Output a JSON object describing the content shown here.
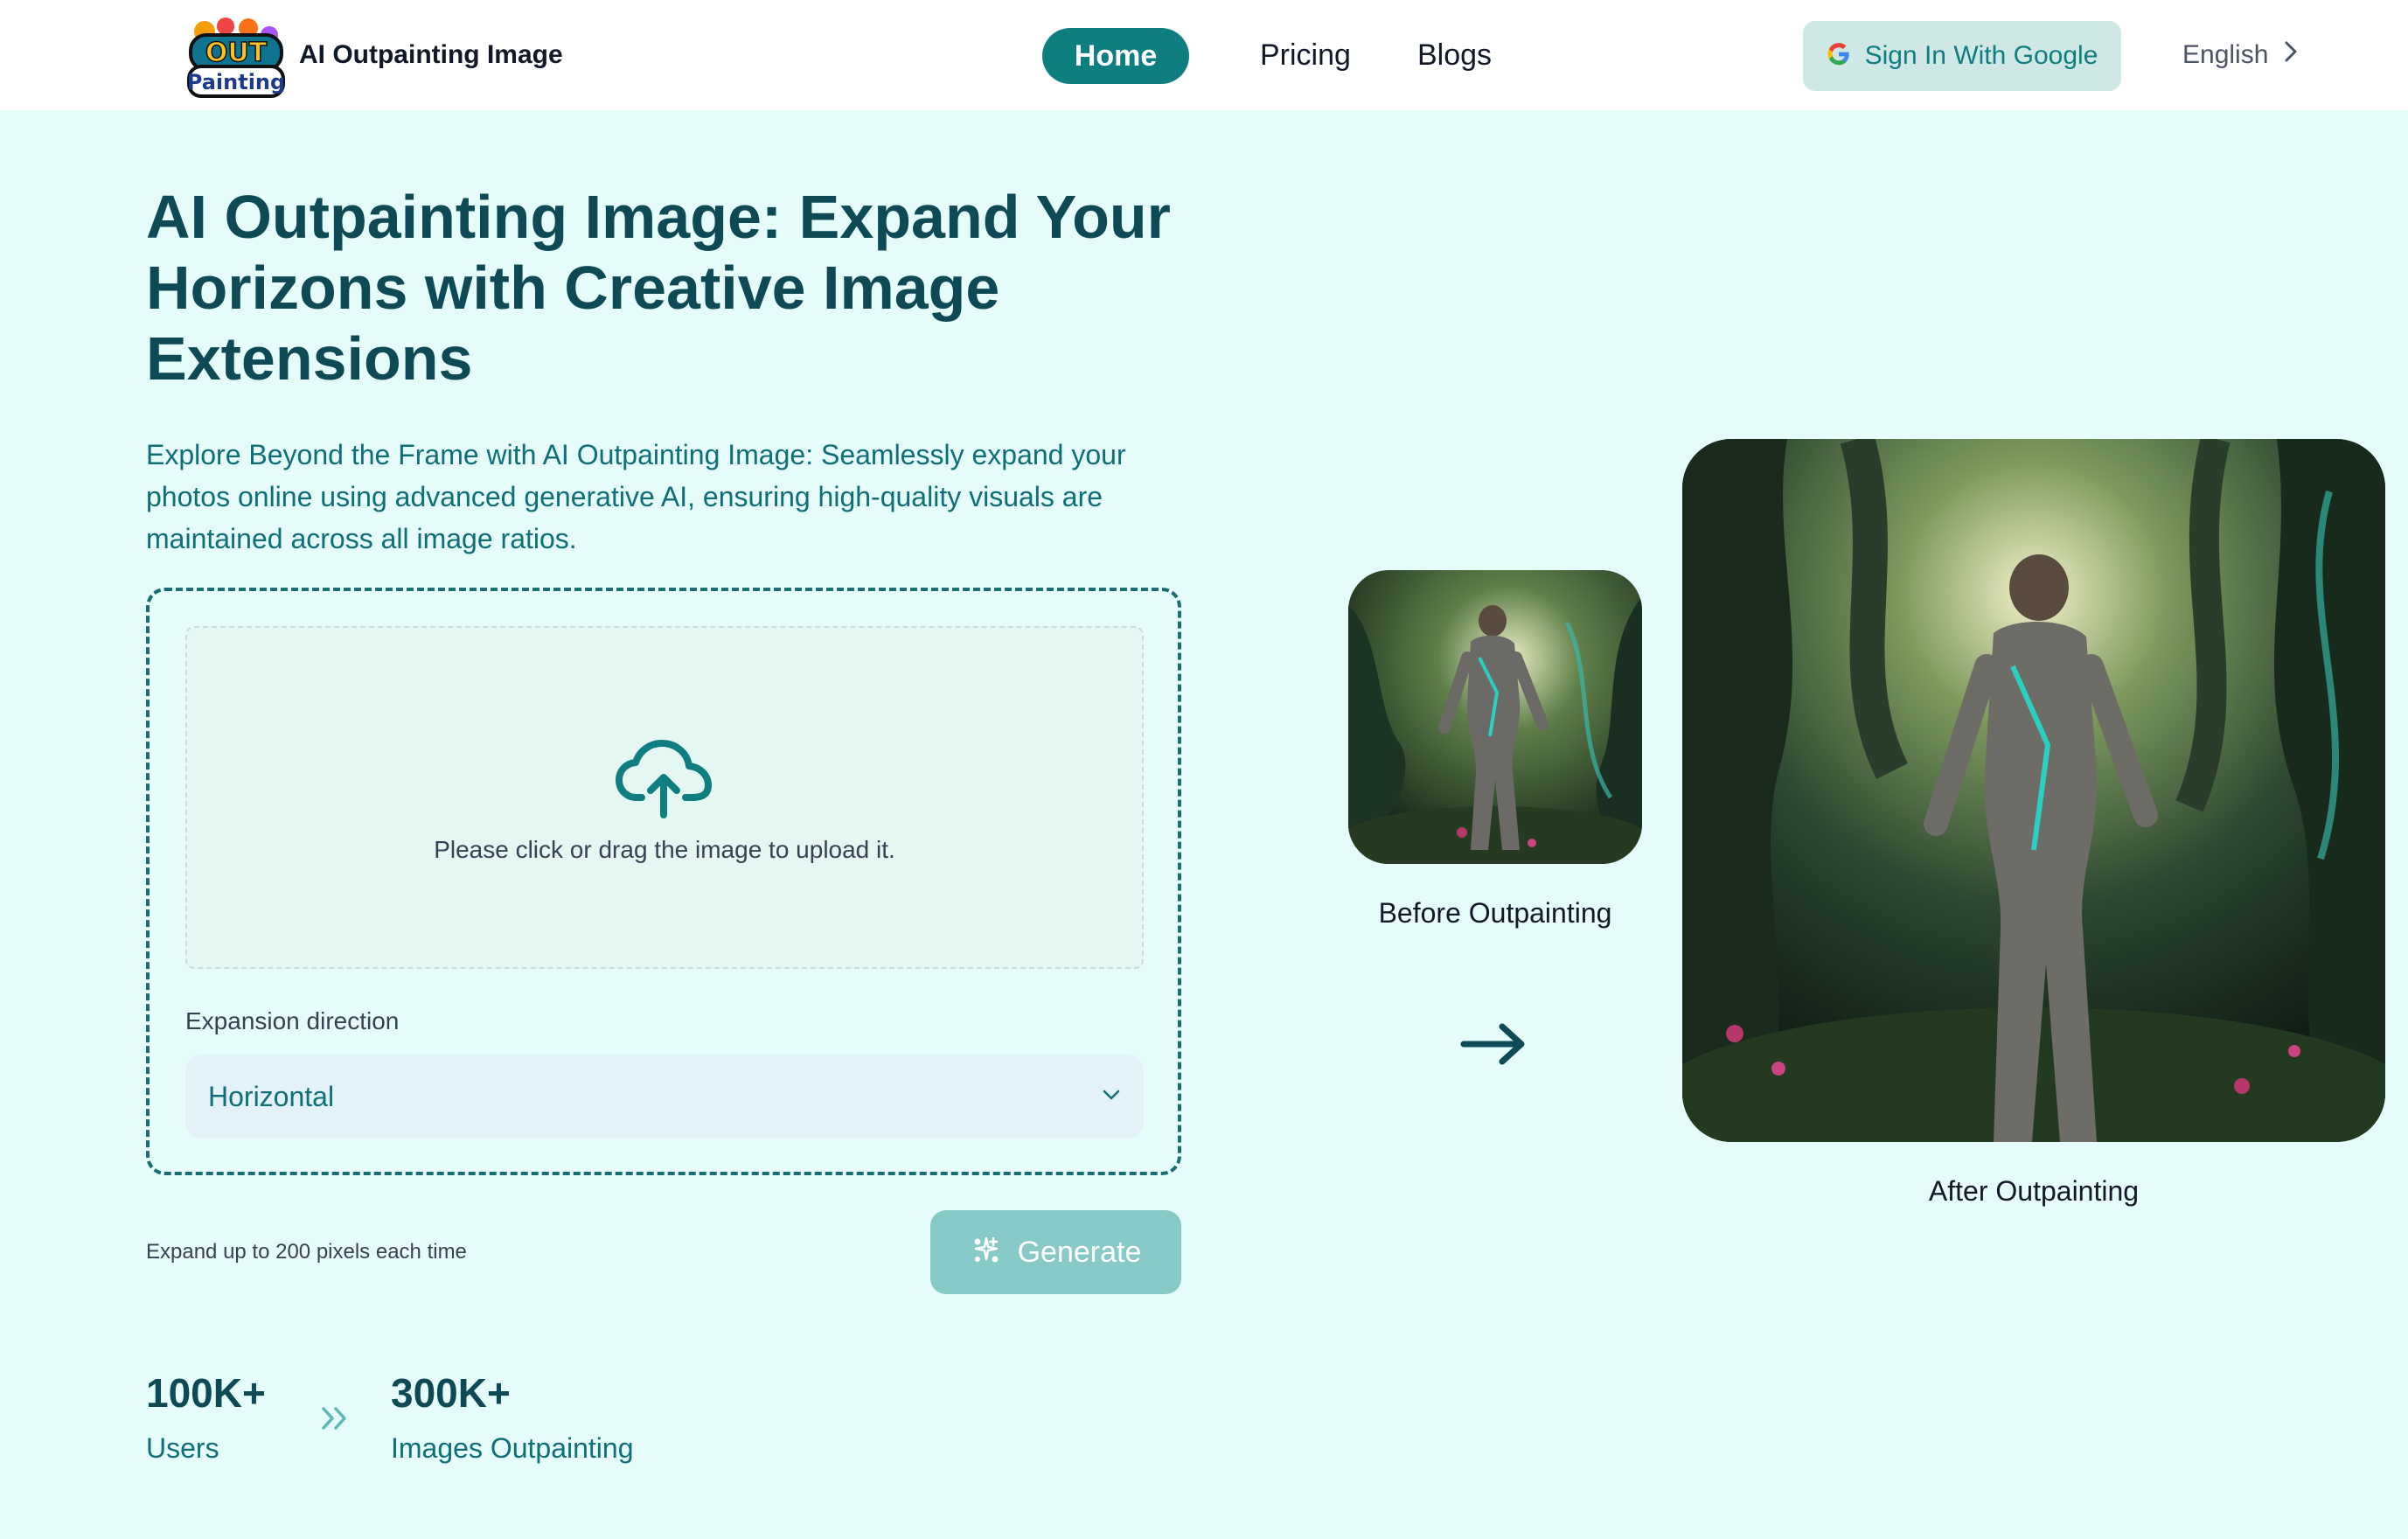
{
  "header": {
    "logo_text": "OUT Painting",
    "brand": "AI Outpainting Image",
    "nav": [
      "Home",
      "Pricing",
      "Blogs"
    ],
    "signin_label": "Sign In With Google",
    "language": "English"
  },
  "hero": {
    "title": "AI Outpainting Image: Expand Your Horizons with Creative Image Extensions",
    "description": "Explore Beyond the Frame with AI Outpainting Image: Seamlessly expand your photos online using advanced generative AI, ensuring high-quality visuals are maintained across all image ratios."
  },
  "upload": {
    "hint": "Please click or drag the image to upload it.",
    "expansion_label": "Expansion direction",
    "expansion_value": "Horizontal",
    "note": "Expand up to 200 pixels each time",
    "generate_label": "Generate"
  },
  "stats": [
    {
      "value": "100K+",
      "label": "Users"
    },
    {
      "value": "300K+",
      "label": "Images Outpainting"
    }
  ],
  "showcase": {
    "before_caption": "Before Outpainting",
    "after_caption": "After Outpainting"
  },
  "colors": {
    "accent": "#0f7e80",
    "page_bg": "#e6fcfa",
    "heading": "#0d4a56",
    "generate_disabled": "#86c9c6"
  }
}
